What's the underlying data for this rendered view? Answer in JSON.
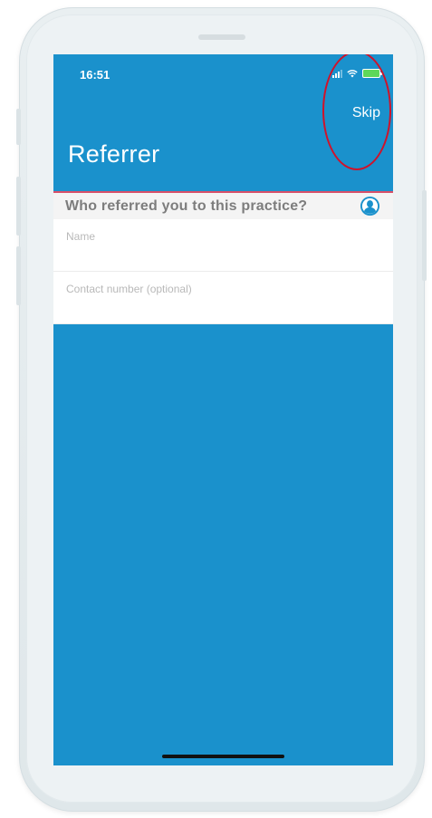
{
  "status_bar": {
    "time": "16:51",
    "icons": [
      "signal-icon",
      "wifi-icon",
      "battery-icon"
    ]
  },
  "header": {
    "skip_label": "Skip",
    "title": "Referrer"
  },
  "section": {
    "question": "Who referred you to this practice?",
    "icon": "contact-person-icon"
  },
  "form": {
    "name_placeholder": "Name",
    "name_value": "",
    "contact_placeholder": "Contact number (optional)",
    "contact_value": ""
  },
  "colors": {
    "screen_background": "#1a91cc",
    "accent_line": "#d8506a",
    "annotation_ring": "#d0122a",
    "battery": "#5ed85a"
  }
}
